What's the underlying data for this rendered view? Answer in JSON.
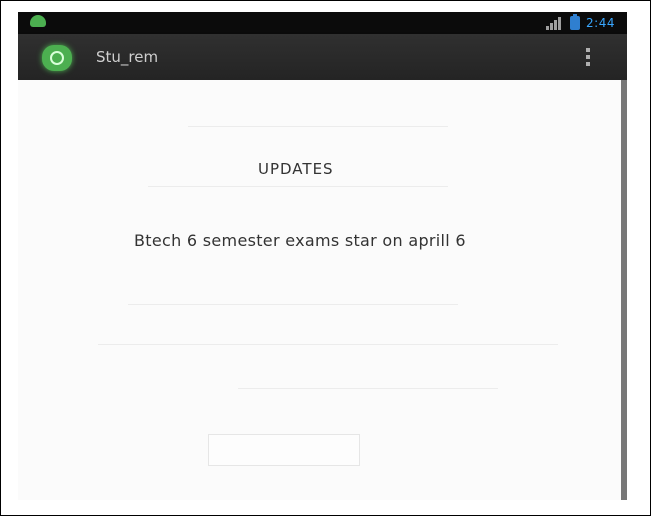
{
  "status_bar": {
    "time": "2:44",
    "icons": [
      "android-icon",
      "signal-icon",
      "battery-icon"
    ]
  },
  "action_bar": {
    "title": "Stu_rem",
    "icons": [
      "app-logo-icon",
      "overflow-menu-icon"
    ]
  },
  "content": {
    "heading": "UPDATES",
    "message": "Btech 6 semester exams star on aprill 6"
  },
  "colors": {
    "status_time": "#39a7ff",
    "action_bar": "#2a2a2a",
    "app_icon": "#4caf50"
  }
}
